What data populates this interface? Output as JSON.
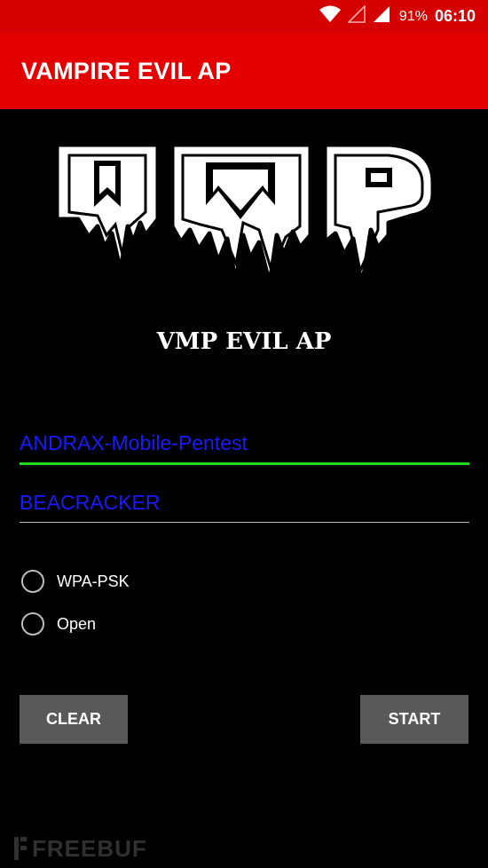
{
  "status_bar": {
    "battery": "91%",
    "time": "06:10",
    "icons": [
      "wifi-icon",
      "signal-empty-icon",
      "signal-full-icon"
    ]
  },
  "app_bar": {
    "title": "VAMPIRE EVIL AP"
  },
  "logo": {
    "text": "VMP"
  },
  "subtitle": "VMP EVIL AP",
  "form": {
    "ssid": {
      "value": "ANDRAX-Mobile-Pentest"
    },
    "password": {
      "value": "BEACRACKER"
    },
    "security_options": [
      {
        "label": "WPA-PSK",
        "checked": false
      },
      {
        "label": "Open",
        "checked": false
      }
    ]
  },
  "buttons": {
    "clear": "CLEAR",
    "start": "START"
  },
  "watermark": "FREEBUF",
  "colors": {
    "status_bar": "#d50000",
    "app_bar": "#e50000",
    "background": "#000000",
    "input_text": "#1a1aff",
    "active_underline": "#22d822",
    "button": "#595959"
  }
}
